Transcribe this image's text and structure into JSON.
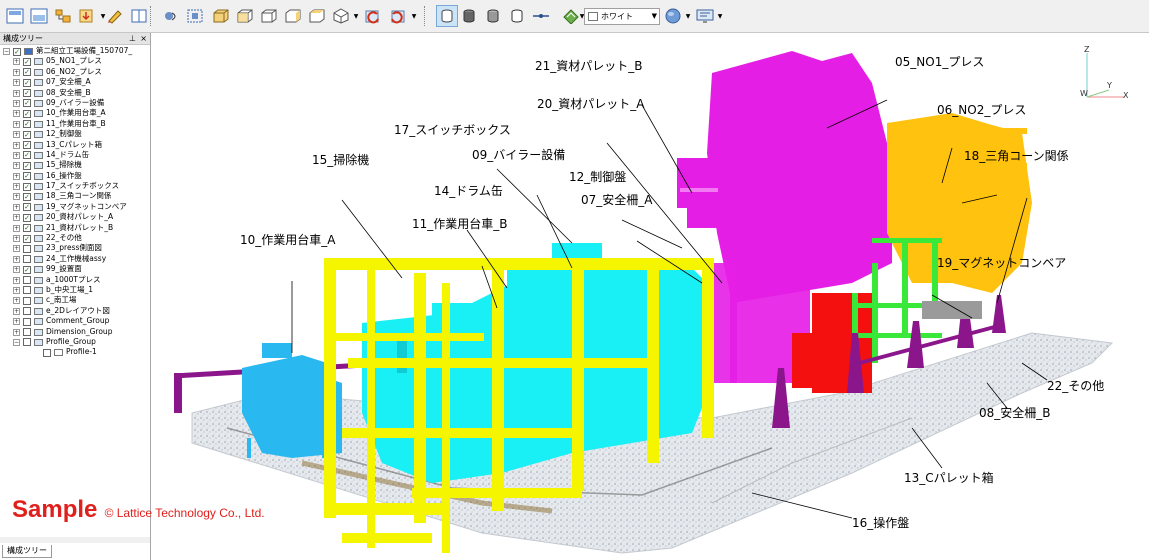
{
  "toolbar": {
    "display_color": "ホワイト",
    "buttons": [
      {
        "name": "new-doc-icon"
      },
      {
        "name": "open-icon"
      },
      {
        "name": "assembly-icon"
      },
      {
        "name": "import-icon"
      },
      {
        "name": "pen-icon"
      },
      {
        "name": "book-icon"
      },
      {
        "name": "orbit-icon"
      },
      {
        "name": "fit-icon"
      },
      {
        "name": "view-front-icon"
      },
      {
        "name": "view-back-icon"
      },
      {
        "name": "view-left-icon"
      },
      {
        "name": "view-right-icon"
      },
      {
        "name": "view-top-icon"
      },
      {
        "name": "view-iso-icon"
      },
      {
        "name": "undo-view-icon"
      },
      {
        "name": "redo-view-icon"
      },
      {
        "name": "shading-icon"
      },
      {
        "name": "solid-icon"
      },
      {
        "name": "wire-icon"
      },
      {
        "name": "line-icon"
      },
      {
        "name": "texture-icon"
      },
      {
        "name": "sphere-icon"
      },
      {
        "name": "screen-icon"
      }
    ]
  },
  "panel": {
    "title": "構成ツリー",
    "tab": "構成ツリー",
    "tree": [
      {
        "label": "第二組立工場設備_150707_",
        "level": 0,
        "checked": true,
        "expanded": true,
        "root": true
      },
      {
        "label": "05_NO1_プレス",
        "level": 1,
        "checked": true
      },
      {
        "label": "06_NO2_プレス",
        "level": 1,
        "checked": true
      },
      {
        "label": "07_安全柵_A",
        "level": 1,
        "checked": true
      },
      {
        "label": "08_安全柵_B",
        "level": 1,
        "checked": true
      },
      {
        "label": "09_バイラー設備",
        "level": 1,
        "checked": true
      },
      {
        "label": "10_作業用台車_A",
        "level": 1,
        "checked": true
      },
      {
        "label": "11_作業用台車_B",
        "level": 1,
        "checked": true
      },
      {
        "label": "12_制御盤",
        "level": 1,
        "checked": true
      },
      {
        "label": "13_Cパレット箱",
        "level": 1,
        "checked": true
      },
      {
        "label": "14_ドラム缶",
        "level": 1,
        "checked": true
      },
      {
        "label": "15_掃除機",
        "level": 1,
        "checked": true
      },
      {
        "label": "16_操作盤",
        "level": 1,
        "checked": true
      },
      {
        "label": "17_スイッチボックス",
        "level": 1,
        "checked": true
      },
      {
        "label": "18_三角コーン関係",
        "level": 1,
        "checked": true
      },
      {
        "label": "19_マグネットコンベア",
        "level": 1,
        "checked": true
      },
      {
        "label": "20_資材パレット_A",
        "level": 1,
        "checked": true
      },
      {
        "label": "21_資材パレット_B",
        "level": 1,
        "checked": true
      },
      {
        "label": "22_その他",
        "level": 1,
        "checked": true
      },
      {
        "label": "23_press側面図",
        "level": 1,
        "checked": false
      },
      {
        "label": "24_工作機械assy",
        "level": 1,
        "checked": false
      },
      {
        "label": "99_設置面",
        "level": 1,
        "checked": true
      },
      {
        "label": "a_1000Tプレス",
        "level": 1,
        "checked": false
      },
      {
        "label": "b_中央工場_1",
        "level": 1,
        "checked": false
      },
      {
        "label": "c_南工場",
        "level": 1,
        "checked": false
      },
      {
        "label": "e_2Dレイアウト図",
        "level": 1,
        "checked": false
      },
      {
        "label": "Comment_Group",
        "level": 1,
        "checked": false
      },
      {
        "label": "Dimension_Group",
        "level": 1,
        "checked": false
      },
      {
        "label": "Profile_Group",
        "level": 1,
        "checked": false,
        "expanded": true
      },
      {
        "label": "Profile-1",
        "level": 2,
        "checked": false,
        "leaf": true
      }
    ]
  },
  "viewport": {
    "callouts": [
      {
        "text": "21_資材パレット_B"
      },
      {
        "text": "05_NO1_プレス"
      },
      {
        "text": "20_資材パレット_A"
      },
      {
        "text": "06_NO2_プレス"
      },
      {
        "text": "17_スイッチボックス"
      },
      {
        "text": "09_バイラー設備"
      },
      {
        "text": "18_三角コーン関係"
      },
      {
        "text": "15_掃除機"
      },
      {
        "text": "12_制御盤"
      },
      {
        "text": "14_ドラム缶"
      },
      {
        "text": "07_安全柵_A"
      },
      {
        "text": "11_作業用台車_B"
      },
      {
        "text": "10_作業用台車_A"
      },
      {
        "text": "19_マグネットコンベア"
      },
      {
        "text": "22_その他"
      },
      {
        "text": "08_安全柵_B"
      },
      {
        "text": "13_Cパレット箱"
      },
      {
        "text": "16_操作盤"
      }
    ],
    "axes": {
      "x": "X",
      "y": "Y",
      "z": "Z"
    },
    "colors": {
      "press": "#e51ee5",
      "pallet_yellow": "#ffc20e",
      "frame_yellow": "#f5f500",
      "cyan_equipment": "#19f0f5",
      "cart_blue": "#2ab8f0",
      "green_conveyor": "#3ae83a",
      "red_panel": "#f51010",
      "cones": "#8b168b",
      "floor": "#d8dde2"
    }
  },
  "watermark": {
    "sample": "Sample",
    "copyright": "© Lattice Technology Co., Ltd."
  }
}
